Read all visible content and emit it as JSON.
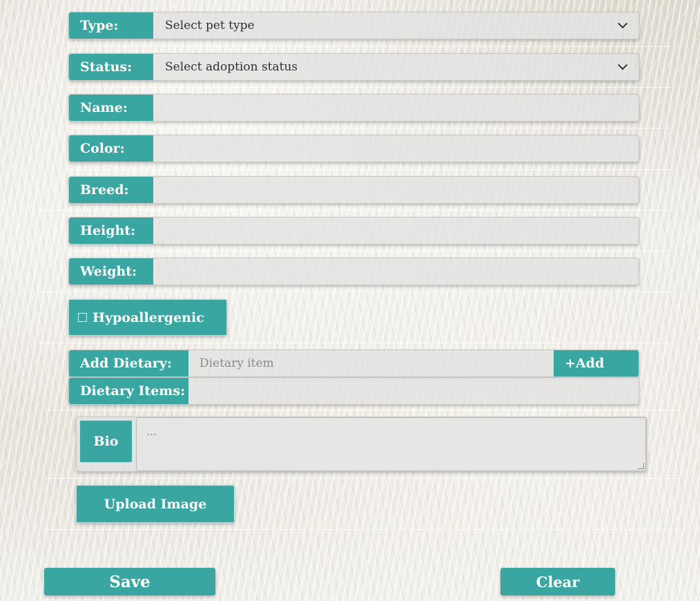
{
  "form": {
    "type": {
      "label": "Type:",
      "value": "Select pet type"
    },
    "status": {
      "label": "Status:",
      "value": "Select adoption status"
    },
    "name": {
      "label": "Name:",
      "value": ""
    },
    "color": {
      "label": "Color:",
      "value": ""
    },
    "breed": {
      "label": "Breed:",
      "value": ""
    },
    "height": {
      "label": "Height:",
      "value": ""
    },
    "weight": {
      "label": "Weight:",
      "value": ""
    },
    "hypoallergenic": {
      "label": "Hypoallergenic",
      "checked": false
    },
    "dietary": {
      "add_label": "Add Dietary:",
      "input_placeholder": "Dietary item",
      "add_button": "+Add",
      "items_label": "Dietary Items:",
      "items": []
    },
    "bio": {
      "label": "Bio",
      "placeholder": "..."
    },
    "upload_button": "Upload Image",
    "save_button": "Save",
    "clear_button": "Clear"
  },
  "colors": {
    "accent": "#3aa6a2",
    "field_bg": "#e2e2e2",
    "text": "#2f2f2f"
  }
}
